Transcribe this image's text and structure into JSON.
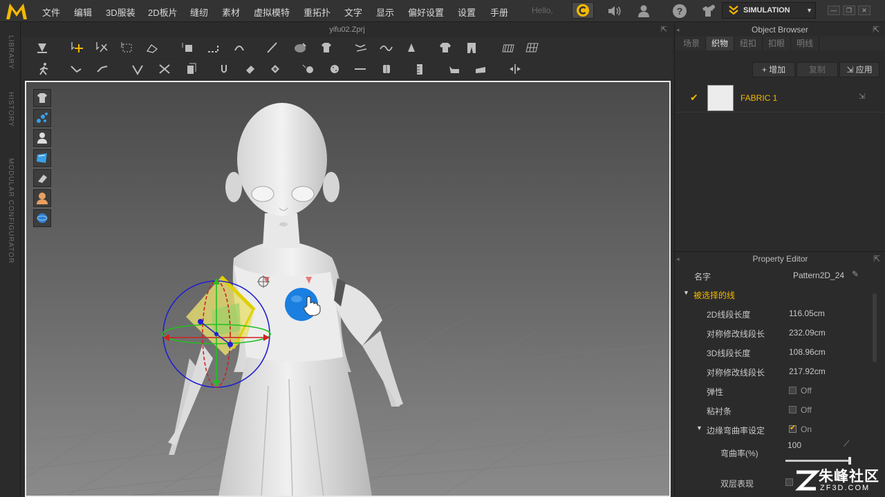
{
  "menubar": {
    "items": [
      "文件",
      "编辑",
      "3D服装",
      "2D板片",
      "缝纫",
      "素材",
      "虚拟模特",
      "重拓扑",
      "文字",
      "显示",
      "偏好设置",
      "设置",
      "手册"
    ],
    "hello": "Hello,",
    "simulation_label": "SIMULATION"
  },
  "left_rail": {
    "library": "LIBRARY",
    "history": "HISTORY",
    "modular": "MODULAR CONFIGURATOR"
  },
  "viewport": {
    "file_title": "yifu02.Zprj"
  },
  "object_browser": {
    "title": "Object Browser",
    "tabs": [
      {
        "label": "场景",
        "active": false
      },
      {
        "label": "织物",
        "active": true
      },
      {
        "label": "纽扣",
        "active": false
      },
      {
        "label": "扣眼",
        "active": false
      },
      {
        "label": "明线",
        "active": false
      }
    ],
    "add_label": "增加",
    "copy_label": "复制",
    "apply_label": "应用",
    "fabric_name": "FABRIC 1"
  },
  "property_editor": {
    "title": "Property Editor",
    "name_label": "名字",
    "name_value": "Pattern2D_24",
    "section_selected_line": "被选择的线",
    "rows": [
      {
        "label": "2D线段长度",
        "value": "116.05cm"
      },
      {
        "label": "对称修改线段长",
        "value": "232.09cm"
      },
      {
        "label": "3D线段长度",
        "value": "108.96cm"
      },
      {
        "label": "对称修改线段长",
        "value": "217.92cm"
      }
    ],
    "elastic_label": "弹性",
    "elastic_value": "Off",
    "tape_label": "粘衬条",
    "tape_value": "Off",
    "curvature_section_label": "边缘弯曲率设定",
    "curvature_section_value": "On",
    "curvature_label": "弯曲率(%)",
    "curvature_value": "100",
    "double_label": "双层表现"
  },
  "watermark": {
    "brand": "朱峰社区",
    "domain": "ZF3D.COM"
  },
  "colors": {
    "accent": "#f5b800",
    "selection_blue": "#1a7fe0"
  }
}
